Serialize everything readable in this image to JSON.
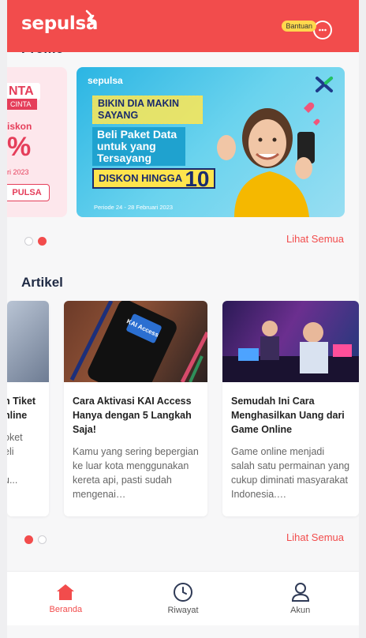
{
  "header": {
    "logo_text": "sepulsa",
    "help_label": "Bantuan"
  },
  "promo": {
    "section_title": "Promo",
    "left_banner": {
      "tag": "NTA",
      "tag_sub": "CINTA",
      "diskon_fragment": "iskon",
      "big_fragment": "%",
      "date_fragment": "ri 2023",
      "button_fragment": "PULSA"
    },
    "main_banner": {
      "logo": "sepulsa",
      "headline": "BIKIN DIA MAKIN SAYANG",
      "subline": "Beli Paket Data untuk yang Tersayang",
      "discount_label": "DISKON HINGGA",
      "discount_value": "10",
      "period": "Periode 24 - 28 Februari 2023"
    },
    "see_all": "Lihat Semua"
  },
  "articles": {
    "section_title": "Artikel",
    "items": [
      {
        "title": "n Tiket\nnline",
        "desc": "oket\neli\n\nu..."
      },
      {
        "title": "Cara Aktivasi KAI Access Hanya dengan 5 Langkah Saja!",
        "desc": "Kamu yang sering bepergian ke luar kota menggunakan kereta api, pasti sudah mengenai…",
        "image_label": "KAI Access"
      },
      {
        "title": "Semudah Ini Cara Menghasilkan Uang dari Game Online",
        "desc": "Game online menjadi salah satu permainan yang cukup diminati masyarakat Indonesia.…"
      }
    ],
    "see_all": "Lihat Semua"
  },
  "bottom_nav": {
    "items": [
      {
        "label": "Beranda",
        "icon": "home-icon",
        "active": true
      },
      {
        "label": "Riwayat",
        "icon": "clock-icon",
        "active": false
      },
      {
        "label": "Akun",
        "icon": "user-icon",
        "active": false
      }
    ]
  },
  "colors": {
    "brand": "#f24c4c",
    "title": "#1f2a44"
  }
}
